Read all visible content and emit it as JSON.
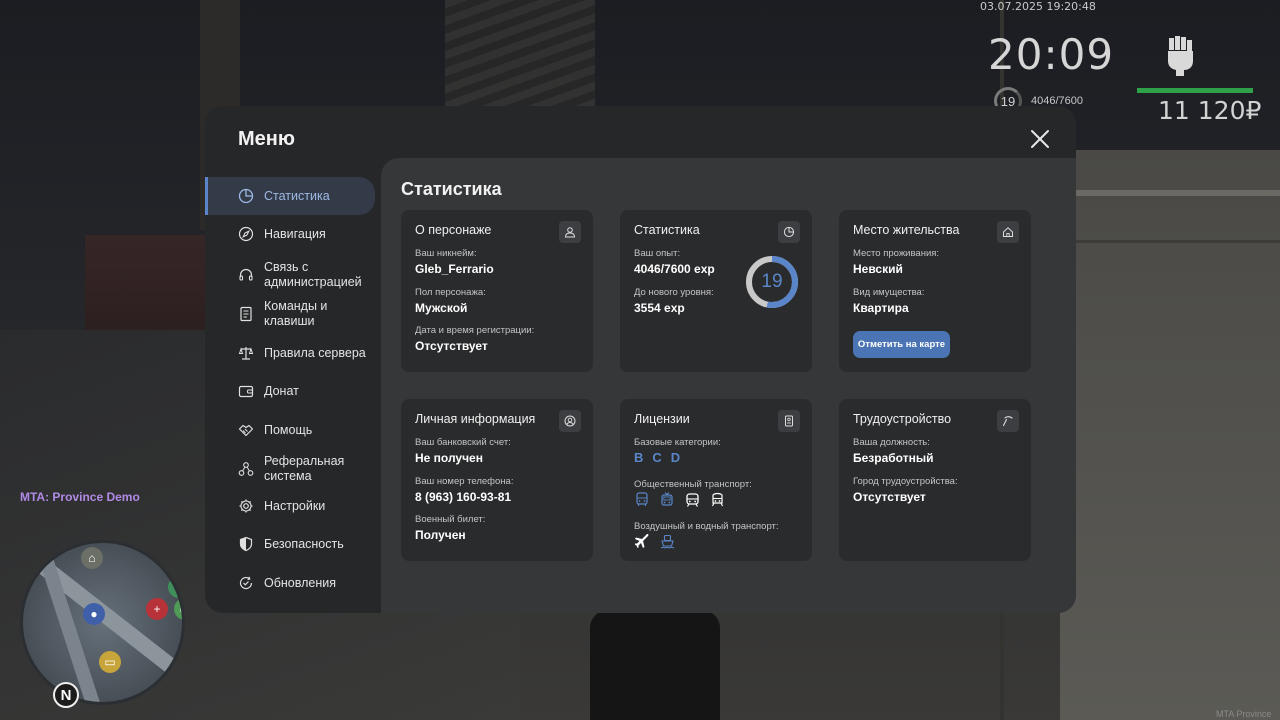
{
  "hud": {
    "datetime": "03.07.2025 19:20:48",
    "time": "20:09",
    "level": "19",
    "exp": "4046/7600",
    "money": "11 120₽",
    "server_name": "MTA: Province Demo",
    "watermark": "MTA Province"
  },
  "menu": {
    "title": "Меню",
    "sidebar": [
      {
        "label": "Статистика",
        "icon": "pie-chart-icon",
        "active": true
      },
      {
        "label": "Навигация",
        "icon": "compass-icon"
      },
      {
        "label": "Связь с администрацией",
        "icon": "headset-icon"
      },
      {
        "label": "Команды и клавиши",
        "icon": "document-icon"
      },
      {
        "label": "Правила сервера",
        "icon": "scales-icon"
      },
      {
        "label": "Донат",
        "icon": "wallet-icon"
      },
      {
        "label": "Помощь",
        "icon": "handshake-icon"
      },
      {
        "label": "Реферальная система",
        "icon": "network-icon"
      },
      {
        "label": "Настройки",
        "icon": "gear-icon"
      },
      {
        "label": "Безопасность",
        "icon": "shield-icon"
      },
      {
        "label": "Обновления",
        "icon": "refresh-check-icon"
      }
    ],
    "content_title": "Статистика",
    "cards": {
      "character": {
        "title": "О персонаже",
        "nickname_label": "Ваш никнейм:",
        "nickname": "Gleb_Ferrario",
        "gender_label": "Пол персонажа:",
        "gender": "Мужской",
        "reg_label": "Дата и время регистрации:",
        "reg": "Отсутствует"
      },
      "stats": {
        "title": "Статистика",
        "exp_label": "Ваш опыт:",
        "exp": "4046/7600 exp",
        "next_label": "До нового уровня:",
        "next": "3554 exp",
        "level": "19",
        "progress": 0.532
      },
      "residence": {
        "title": "Место жительства",
        "place_label": "Место проживания:",
        "place": "Невский",
        "property_label": "Вид имущества:",
        "property": "Квартира",
        "button": "Отметить на карте"
      },
      "personal": {
        "title": "Личная информация",
        "bank_label": "Ваш банковский счет:",
        "bank": "Не получен",
        "phone_label": "Ваш номер телефона:",
        "phone": "8 (963) 160-93-81",
        "military_label": "Военный билет:",
        "military": "Получен"
      },
      "licenses": {
        "title": "Лицензии",
        "base_label": "Базовые категории:",
        "categories": [
          "B",
          "C",
          "D"
        ],
        "public_label": "Общественный транспорт:",
        "public_icons": [
          "bus-icon",
          "trolleybus-icon",
          "tram-icon",
          "metro-icon"
        ],
        "air_label": "Воздушный и водный транспорт:",
        "air_icons": [
          "plane-icon",
          "ship-icon"
        ]
      },
      "employment": {
        "title": "Трудоустройство",
        "position_label": "Ваша должность:",
        "position": "Безработный",
        "city_label": "Город трудоустройства:",
        "city": "Отсутствует"
      }
    }
  },
  "colors": {
    "accent": "#5a86c9",
    "button": "#4a74b3",
    "active_nav_bg": "#343b48",
    "card_bg": "#2a2b2d",
    "panel_bg": "#363739",
    "health_bar": "#2fa14a",
    "server_name": "#b18ae6"
  }
}
